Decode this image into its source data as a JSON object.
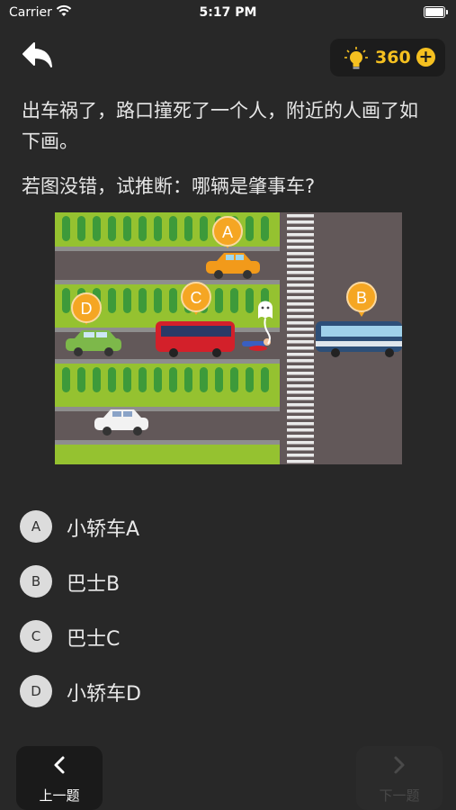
{
  "status_bar": {
    "carrier": "Carrier",
    "time": "5:17 PM"
  },
  "header": {
    "hint_count": "360",
    "plus_symbol": "+"
  },
  "question": {
    "line1": "出车祸了，路口撞死了一个人，附近的人画了如下画。",
    "line2": "若图没错，试推断：哪辆是肇事车?"
  },
  "scene_markers": {
    "a": "A",
    "b": "B",
    "c": "C",
    "d": "D"
  },
  "options": [
    {
      "letter": "A",
      "text": "小轿车A"
    },
    {
      "letter": "B",
      "text": "巴士B"
    },
    {
      "letter": "C",
      "text": "巴士C"
    },
    {
      "letter": "D",
      "text": "小轿车D"
    }
  ],
  "footer": {
    "prev_label": "上一题",
    "next_label": "下一题"
  },
  "colors": {
    "accent": "#f5c020",
    "background": "#282828",
    "grass": "#95c230",
    "road": "#625859",
    "marker": "#f5a623"
  }
}
